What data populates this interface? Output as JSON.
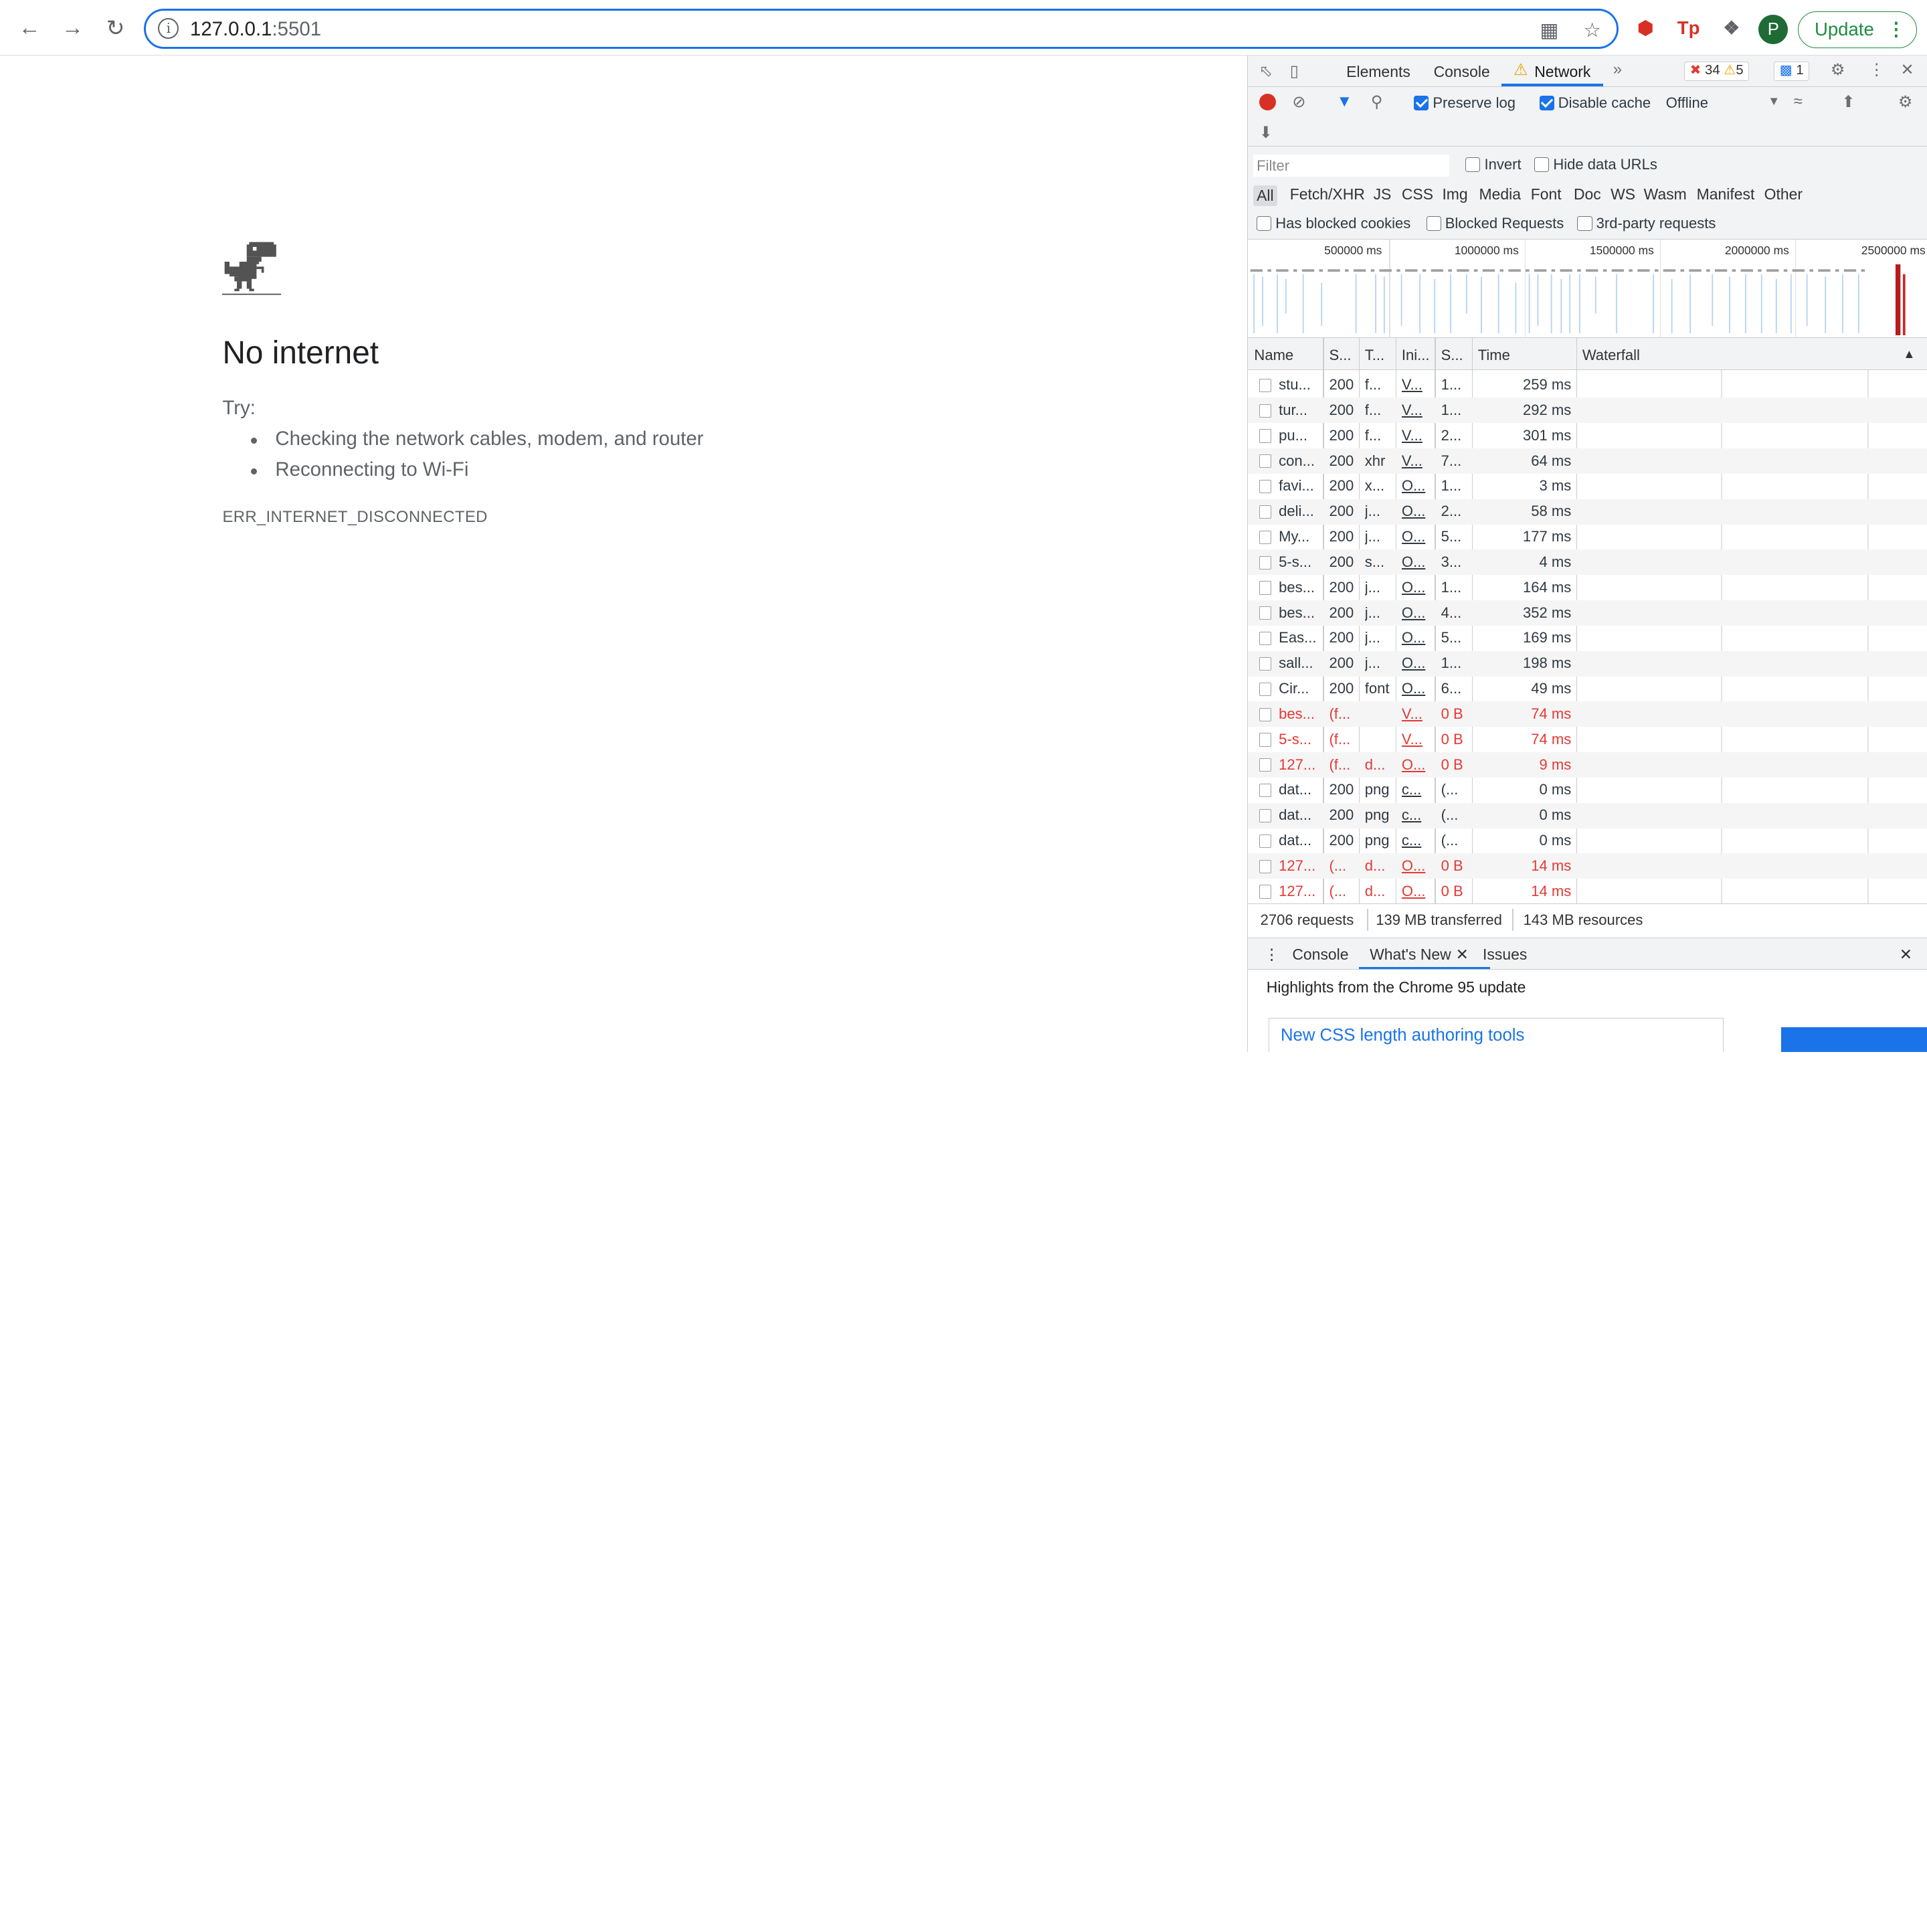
{
  "browser": {
    "url_host": "127.0.0.1",
    "url_port": ":5501",
    "update_label": "Update",
    "avatar_letter": "P"
  },
  "offline": {
    "title": "No internet",
    "try_label": "Try:",
    "suggestions": [
      "Checking the network cables, modem, and router",
      "Reconnecting to Wi-Fi"
    ],
    "error_code": "ERR_INTERNET_DISCONNECTED"
  },
  "devtools": {
    "tabs": [
      "Elements",
      "Console",
      "Network"
    ],
    "errors_count": "34",
    "warnings_count": "5",
    "messages_count": "1",
    "preserve_log": "Preserve log",
    "disable_cache": "Disable cache",
    "throttle": "Offline",
    "filter_placeholder": "Filter",
    "invert": "Invert",
    "hide_data_urls": "Hide data URLs",
    "types": [
      "All",
      "Fetch/XHR",
      "JS",
      "CSS",
      "Img",
      "Media",
      "Font",
      "Doc",
      "WS",
      "Wasm",
      "Manifest",
      "Other"
    ],
    "has_blocked_cookies": "Has blocked cookies",
    "blocked_requests": "Blocked Requests",
    "third_party": "3rd-party requests",
    "timeline_labels": [
      "500000 ms",
      "1000000 ms",
      "1500000 ms",
      "2000000 ms",
      "2500000 ms"
    ],
    "columns": [
      "Name",
      "S...",
      "T...",
      "Ini...",
      "S...",
      "Time",
      "Waterfall"
    ],
    "rows": [
      {
        "name": "stu...",
        "status": "200",
        "type": "f...",
        "init": "V...",
        "size": "1...",
        "time": "259 ms",
        "error": false
      },
      {
        "name": "tur...",
        "status": "200",
        "type": "f...",
        "init": "V...",
        "size": "1...",
        "time": "292 ms",
        "error": false
      },
      {
        "name": "pu...",
        "status": "200",
        "type": "f...",
        "init": "V...",
        "size": "2...",
        "time": "301 ms",
        "error": false
      },
      {
        "name": "con...",
        "status": "200",
        "type": "xhr",
        "init": "V...",
        "size": "7...",
        "time": "64 ms",
        "error": false
      },
      {
        "name": "favi...",
        "status": "200",
        "type": "x...",
        "init": "O...",
        "size": "1...",
        "time": "3 ms",
        "error": false
      },
      {
        "name": "deli...",
        "status": "200",
        "type": "j...",
        "init": "O...",
        "size": "2...",
        "time": "58 ms",
        "error": false
      },
      {
        "name": "My...",
        "status": "200",
        "type": "j...",
        "init": "O...",
        "size": "5...",
        "time": "177 ms",
        "error": false
      },
      {
        "name": "5-s...",
        "status": "200",
        "type": "s...",
        "init": "O...",
        "size": "3...",
        "time": "4 ms",
        "error": false
      },
      {
        "name": "bes...",
        "status": "200",
        "type": "j...",
        "init": "O...",
        "size": "1...",
        "time": "164 ms",
        "error": false
      },
      {
        "name": "bes...",
        "status": "200",
        "type": "j...",
        "init": "O...",
        "size": "4...",
        "time": "352 ms",
        "error": false
      },
      {
        "name": "Eas...",
        "status": "200",
        "type": "j...",
        "init": "O...",
        "size": "5...",
        "time": "169 ms",
        "error": false
      },
      {
        "name": "sall...",
        "status": "200",
        "type": "j...",
        "init": "O...",
        "size": "1...",
        "time": "198 ms",
        "error": false
      },
      {
        "name": "Cir...",
        "status": "200",
        "type": "font",
        "init": "O...",
        "size": "6...",
        "time": "49 ms",
        "error": false
      },
      {
        "name": "bes...",
        "status": "(f...",
        "type": "",
        "init": "V...",
        "size": "0 B",
        "time": "74 ms",
        "error": true
      },
      {
        "name": "5-s...",
        "status": "(f...",
        "type": "",
        "init": "V...",
        "size": "0 B",
        "time": "74 ms",
        "error": true
      },
      {
        "name": "127...",
        "status": "(f...",
        "type": "d...",
        "init": "O...",
        "size": "0 B",
        "time": "9 ms",
        "error": true
      },
      {
        "name": "dat...",
        "status": "200",
        "type": "png",
        "init": "c...",
        "size": "(...",
        "time": "0 ms",
        "error": false
      },
      {
        "name": "dat...",
        "status": "200",
        "type": "png",
        "init": "c...",
        "size": "(...",
        "time": "0 ms",
        "error": false
      },
      {
        "name": "dat...",
        "status": "200",
        "type": "png",
        "init": "c...",
        "size": "(...",
        "time": "0 ms",
        "error": false
      },
      {
        "name": "127...",
        "status": "(...",
        "type": "d...",
        "init": "O...",
        "size": "0 B",
        "time": "14 ms",
        "error": true
      },
      {
        "name": "127...",
        "status": "(...",
        "type": "d...",
        "init": "O...",
        "size": "0 B",
        "time": "14 ms",
        "error": true
      }
    ],
    "summary_requests": "2706 requests",
    "summary_transferred": "139 MB transferred",
    "summary_resources": "143 MB resources",
    "drawer_tabs": [
      "Console",
      "What's New",
      "Issues"
    ],
    "highlights": "Highlights from the Chrome 95 update",
    "css_card_title": "New CSS length authoring tools"
  },
  "colors": {
    "accent": "#1a73e8",
    "error_red": "#e53935",
    "update_green": "#1e8e3e"
  }
}
